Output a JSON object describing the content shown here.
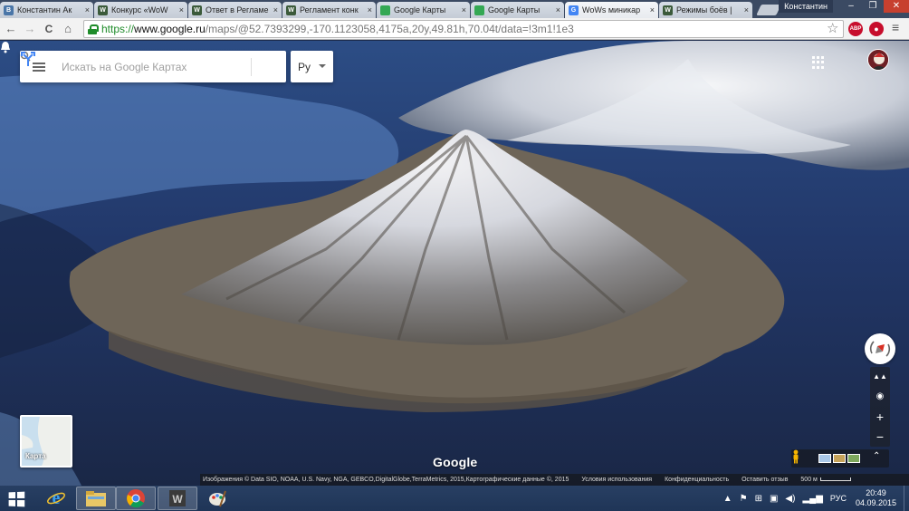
{
  "browser": {
    "tabs": [
      {
        "label": "Константин Ак",
        "favicon_text": "B",
        "favicon_color": "#4a76a8",
        "active": false
      },
      {
        "label": "Конкурс «WoW",
        "favicon_text": "W",
        "favicon_color": "#3b5a3a",
        "active": false
      },
      {
        "label": "Ответ в Регламе",
        "favicon_text": "W",
        "favicon_color": "#3b5a3a",
        "active": false
      },
      {
        "label": "Регламент конк",
        "favicon_text": "W",
        "favicon_color": "#3b5a3a",
        "active": false
      },
      {
        "label": "Google Карты",
        "favicon_text": "",
        "favicon_color": "#34a853",
        "active": false
      },
      {
        "label": "Google Карты",
        "favicon_text": "",
        "favicon_color": "#34a853",
        "active": false
      },
      {
        "label": "WoWs миникар",
        "favicon_text": "G",
        "favicon_color": "#4285f4",
        "active": true
      },
      {
        "label": "Режимы боёв |",
        "favicon_text": "W",
        "favicon_color": "#3b5a3a",
        "active": false
      }
    ],
    "close_glyph": "×",
    "profile_name": "Константин",
    "window_buttons": {
      "minimize": "–",
      "maximize": "❐",
      "close": "✕"
    },
    "nav": {
      "back": "←",
      "forward": "→",
      "reload": "C",
      "home": "⌂"
    },
    "url": {
      "scheme": "https://",
      "host": "www.google.ru",
      "path": "/maps/@52.7393299,-170.1123058,4175a,20y,49.81h,70.04t/data=!3m1!1e3"
    },
    "extensions": {
      "abp": "ABP",
      "rec": "●"
    },
    "star": "☆",
    "menu": "≡"
  },
  "map": {
    "search": {
      "placeholder": "Искать на Google Картах"
    },
    "language": "Ру",
    "minimap_label": "Карта",
    "logo": "Google",
    "controls": {
      "tilt": "▲▲",
      "locate": "◉",
      "zoom_in": "+",
      "zoom_out": "−",
      "expand": "⌃"
    },
    "attribution": [
      "Изображения © Data SIO, NOAA, U.S. Navy, NGA, GEBCO,DigitalGlobe,TerraMetrics, 2015,Картографические данные ©, 2015",
      "Условия использования",
      "Конфиденциальность",
      "Оставить отзыв",
      "500 м"
    ],
    "colors": {
      "ocean": "#1e2e52",
      "accent_blue": "#4285f4"
    }
  },
  "taskbar": {
    "apps": [
      "ie",
      "explorer",
      "chrome",
      "world-of-tanks",
      "paint"
    ],
    "language": "РУС",
    "time": "20:49",
    "date": "04.09.2015"
  }
}
